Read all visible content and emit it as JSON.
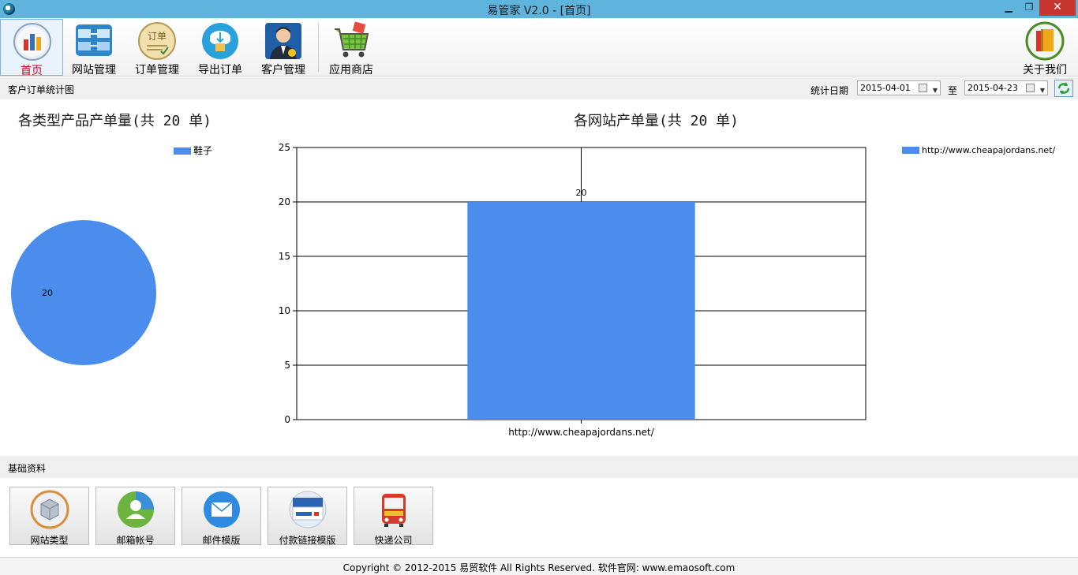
{
  "window": {
    "title": "易管家 V2.0 - [首页]",
    "min": "▁",
    "max": "❐",
    "close": "✕"
  },
  "toolbar": {
    "items": [
      {
        "label": "首页",
        "icon": "chart-icon"
      },
      {
        "label": "网站管理",
        "icon": "website-icon"
      },
      {
        "label": "订单管理",
        "icon": "order-icon"
      },
      {
        "label": "导出订单",
        "icon": "export-icon"
      },
      {
        "label": "客户管理",
        "icon": "customer-icon"
      },
      {
        "label": "应用商店",
        "icon": "cart-icon"
      }
    ],
    "about": {
      "label": "关于我们",
      "icon": "book-icon"
    }
  },
  "stats_bar": {
    "title": "客户订单统计图",
    "date_label": "统计日期",
    "start_date": "2015-04-01",
    "to_label": "至",
    "end_date": "2015-04-23"
  },
  "pie": {
    "title": "各类型产品产单量(共 20 单)",
    "legend": "鞋子",
    "slice_label": "20"
  },
  "bar": {
    "title": "各网站产单量(共 20 单)",
    "legend": "http://www.cheapajordans.net/"
  },
  "chart_data": [
    {
      "type": "pie",
      "title": "各类型产品产单量(共 20 单)",
      "categories": [
        "鞋子"
      ],
      "values": [
        20
      ],
      "colors": [
        "#4a8ded"
      ],
      "legend_position": "top-right"
    },
    {
      "type": "bar",
      "title": "各网站产单量(共 20 单)",
      "categories": [
        "http://www.cheapajordans.net/"
      ],
      "series": [
        {
          "name": "http://www.cheapajordans.net/",
          "values": [
            20
          ]
        }
      ],
      "ylim": [
        0,
        25
      ],
      "yticks": [
        "0",
        "5",
        "10",
        "15",
        "20",
        "25"
      ],
      "grid": true,
      "data_labels": [
        "20"
      ],
      "colors": [
        "#4a8ded"
      ],
      "legend_position": "top-right"
    }
  ],
  "basic": {
    "title": "基础资料",
    "tiles": [
      {
        "label": "网站类型",
        "icon": "box-icon"
      },
      {
        "label": "邮箱帐号",
        "icon": "user-icon"
      },
      {
        "label": "邮件模版",
        "icon": "mail-icon"
      },
      {
        "label": "付款链接模版",
        "icon": "card-icon"
      },
      {
        "label": "快递公司",
        "icon": "bus-icon"
      }
    ]
  },
  "footer": {
    "text": "Copyright © 2012-2015 易贸软件 All Rights Reserved. 软件官网: www.emaosoft.com"
  }
}
